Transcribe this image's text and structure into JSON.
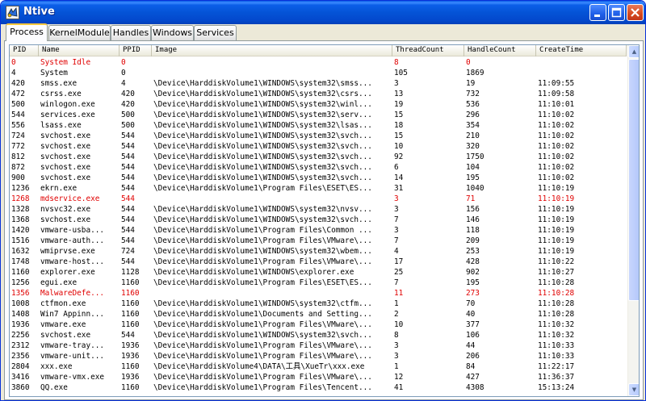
{
  "window": {
    "title": "Ntive"
  },
  "tabs": [
    "Process",
    "KernelModule",
    "Handles",
    "Windows",
    "Services"
  ],
  "columns": [
    "PID",
    "Name",
    "PPID",
    "Image",
    "ThreadCount",
    "HandleCount",
    "CreateTime"
  ],
  "rows": [
    {
      "pid": "0",
      "name": "System Idle",
      "ppid": "0",
      "image": "",
      "threads": "8",
      "handles": "0",
      "time": "",
      "red": true
    },
    {
      "pid": "4",
      "name": "System",
      "ppid": "0",
      "image": "",
      "threads": "105",
      "handles": "1869",
      "time": "",
      "red": false
    },
    {
      "pid": "420",
      "name": "smss.exe",
      "ppid": "4",
      "image": "\\Device\\HarddiskVolume1\\WINDOWS\\system32\\smss...",
      "threads": "3",
      "handles": "19",
      "time": "11:09:55",
      "red": false
    },
    {
      "pid": "472",
      "name": "csrss.exe",
      "ppid": "420",
      "image": "\\Device\\HarddiskVolume1\\WINDOWS\\system32\\csrs...",
      "threads": "13",
      "handles": "732",
      "time": "11:09:58",
      "red": false
    },
    {
      "pid": "500",
      "name": "winlogon.exe",
      "ppid": "420",
      "image": "\\Device\\HarddiskVolume1\\WINDOWS\\system32\\winl...",
      "threads": "19",
      "handles": "536",
      "time": "11:10:01",
      "red": false
    },
    {
      "pid": "544",
      "name": "services.exe",
      "ppid": "500",
      "image": "\\Device\\HarddiskVolume1\\WINDOWS\\system32\\serv...",
      "threads": "15",
      "handles": "296",
      "time": "11:10:02",
      "red": false
    },
    {
      "pid": "556",
      "name": "lsass.exe",
      "ppid": "500",
      "image": "\\Device\\HarddiskVolume1\\WINDOWS\\system32\\lsas...",
      "threads": "18",
      "handles": "354",
      "time": "11:10:02",
      "red": false
    },
    {
      "pid": "724",
      "name": "svchost.exe",
      "ppid": "544",
      "image": "\\Device\\HarddiskVolume1\\WINDOWS\\system32\\svch...",
      "threads": "15",
      "handles": "210",
      "time": "11:10:02",
      "red": false
    },
    {
      "pid": "772",
      "name": "svchost.exe",
      "ppid": "544",
      "image": "\\Device\\HarddiskVolume1\\WINDOWS\\system32\\svch...",
      "threads": "10",
      "handles": "320",
      "time": "11:10:02",
      "red": false
    },
    {
      "pid": "812",
      "name": "svchost.exe",
      "ppid": "544",
      "image": "\\Device\\HarddiskVolume1\\WINDOWS\\system32\\svch...",
      "threads": "92",
      "handles": "1750",
      "time": "11:10:02",
      "red": false
    },
    {
      "pid": "872",
      "name": "svchost.exe",
      "ppid": "544",
      "image": "\\Device\\HarddiskVolume1\\WINDOWS\\system32\\svch...",
      "threads": "6",
      "handles": "104",
      "time": "11:10:02",
      "red": false
    },
    {
      "pid": "900",
      "name": "svchost.exe",
      "ppid": "544",
      "image": "\\Device\\HarddiskVolume1\\WINDOWS\\system32\\svch...",
      "threads": "14",
      "handles": "195",
      "time": "11:10:02",
      "red": false
    },
    {
      "pid": "1236",
      "name": "ekrn.exe",
      "ppid": "544",
      "image": "\\Device\\HarddiskVolume1\\Program Files\\ESET\\ES...",
      "threads": "31",
      "handles": "1040",
      "time": "11:10:19",
      "red": false
    },
    {
      "pid": "1268",
      "name": "mdservice.exe",
      "ppid": "544",
      "image": "",
      "threads": "3",
      "handles": "71",
      "time": "11:10:19",
      "red": true
    },
    {
      "pid": "1328",
      "name": "nvsvc32.exe",
      "ppid": "544",
      "image": "\\Device\\HarddiskVolume1\\WINDOWS\\system32\\nvsv...",
      "threads": "3",
      "handles": "156",
      "time": "11:10:19",
      "red": false
    },
    {
      "pid": "1368",
      "name": "svchost.exe",
      "ppid": "544",
      "image": "\\Device\\HarddiskVolume1\\WINDOWS\\system32\\svch...",
      "threads": "7",
      "handles": "146",
      "time": "11:10:19",
      "red": false
    },
    {
      "pid": "1420",
      "name": "vmware-usba...",
      "ppid": "544",
      "image": "\\Device\\HarddiskVolume1\\Program Files\\Common ...",
      "threads": "3",
      "handles": "118",
      "time": "11:10:19",
      "red": false
    },
    {
      "pid": "1516",
      "name": "vmware-auth...",
      "ppid": "544",
      "image": "\\Device\\HarddiskVolume1\\Program Files\\VMware\\...",
      "threads": "7",
      "handles": "209",
      "time": "11:10:19",
      "red": false
    },
    {
      "pid": "1632",
      "name": "wmiprvse.exe",
      "ppid": "724",
      "image": "\\Device\\HarddiskVolume1\\WINDOWS\\system32\\wbem...",
      "threads": "4",
      "handles": "253",
      "time": "11:10:19",
      "red": false
    },
    {
      "pid": "1748",
      "name": "vmware-host...",
      "ppid": "544",
      "image": "\\Device\\HarddiskVolume1\\Program Files\\VMware\\...",
      "threads": "17",
      "handles": "428",
      "time": "11:10:22",
      "red": false
    },
    {
      "pid": "1160",
      "name": "explorer.exe",
      "ppid": "1128",
      "image": "\\Device\\HarddiskVolume1\\WINDOWS\\explorer.exe",
      "threads": "25",
      "handles": "902",
      "time": "11:10:27",
      "red": false
    },
    {
      "pid": "1256",
      "name": "egui.exe",
      "ppid": "1160",
      "image": "\\Device\\HarddiskVolume1\\Program Files\\ESET\\ES...",
      "threads": "7",
      "handles": "195",
      "time": "11:10:28",
      "red": false
    },
    {
      "pid": "1356",
      "name": "MalwareDefe...",
      "ppid": "1160",
      "image": "",
      "threads": "11",
      "handles": "273",
      "time": "11:10:28",
      "red": true
    },
    {
      "pid": "1008",
      "name": "ctfmon.exe",
      "ppid": "1160",
      "image": "\\Device\\HarddiskVolume1\\WINDOWS\\system32\\ctfm...",
      "threads": "1",
      "handles": "70",
      "time": "11:10:28",
      "red": false
    },
    {
      "pid": "1408",
      "name": "Win7 Appinn...",
      "ppid": "1160",
      "image": "\\Device\\HarddiskVolume1\\Documents and Setting...",
      "threads": "2",
      "handles": "40",
      "time": "11:10:28",
      "red": false
    },
    {
      "pid": "1936",
      "name": "vmware.exe",
      "ppid": "1160",
      "image": "\\Device\\HarddiskVolume1\\Program Files\\VMware\\...",
      "threads": "10",
      "handles": "377",
      "time": "11:10:32",
      "red": false
    },
    {
      "pid": "2256",
      "name": "svchost.exe",
      "ppid": "544",
      "image": "\\Device\\HarddiskVolume1\\WINDOWS\\system32\\svch...",
      "threads": "8",
      "handles": "106",
      "time": "11:10:32",
      "red": false
    },
    {
      "pid": "2312",
      "name": "vmware-tray...",
      "ppid": "1936",
      "image": "\\Device\\HarddiskVolume1\\Program Files\\VMware\\...",
      "threads": "3",
      "handles": "44",
      "time": "11:10:33",
      "red": false
    },
    {
      "pid": "2356",
      "name": "vmware-unit...",
      "ppid": "1936",
      "image": "\\Device\\HarddiskVolume1\\Program Files\\VMware\\...",
      "threads": "3",
      "handles": "206",
      "time": "11:10:33",
      "red": false
    },
    {
      "pid": "2804",
      "name": "xxx.exe",
      "ppid": "1160",
      "image": "\\Device\\HarddiskVolume4\\DATA\\工具\\XueTr\\xxx.exe",
      "threads": "1",
      "handles": "84",
      "time": "11:22:17",
      "red": false
    },
    {
      "pid": "3416",
      "name": "vmware-vmx.exe",
      "ppid": "1936",
      "image": "\\Device\\HarddiskVolume1\\Program Files\\VMware\\...",
      "threads": "12",
      "handles": "427",
      "time": "11:36:37",
      "red": false
    },
    {
      "pid": "3860",
      "name": "QQ.exe",
      "ppid": "1160",
      "image": "\\Device\\HarddiskVolume1\\Program Files\\Tencent...",
      "threads": "41",
      "handles": "4308",
      "time": "15:13:24",
      "red": false
    }
  ],
  "colors": {
    "title_bar": "#0453d6",
    "highlight_red": "#e00000",
    "active_tab_accent": "#ffc83c"
  }
}
